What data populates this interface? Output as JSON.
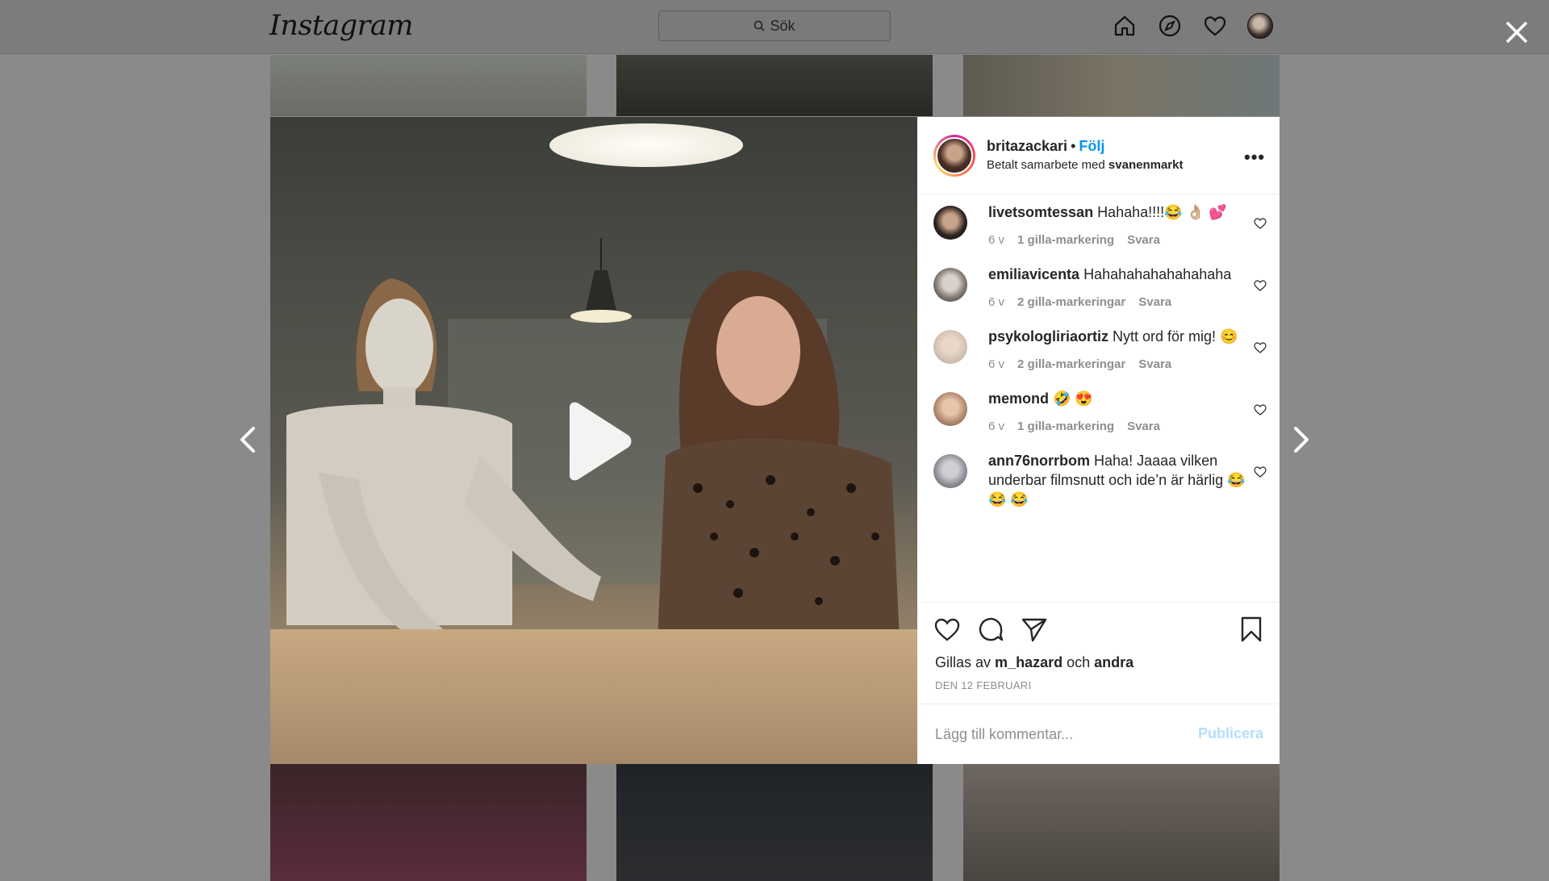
{
  "nav": {
    "logo": "Instagram",
    "search_placeholder": "Sök",
    "icons": [
      "home-icon",
      "explore-icon",
      "activity-heart-icon",
      "profile-avatar"
    ]
  },
  "modal": {
    "author": {
      "username": "britazackari",
      "separator": "•",
      "follow_label": "Följ",
      "paid_prefix": "Betalt samarbete med",
      "partner": "svanenmarkt",
      "more": "•••"
    },
    "comments": [
      {
        "user": "livetsomtessan",
        "text": "Hahaha!!!!😂 👌🏼 💕",
        "age": "6 v",
        "likes": "1 gilla-markering",
        "reply": "Svara"
      },
      {
        "user": "emiliavicenta",
        "text": "Hahahahahahahahaha",
        "age": "6 v",
        "likes": "2 gilla-markeringar",
        "reply": "Svara"
      },
      {
        "user": "psykologliriaortiz",
        "text": "Nytt ord för mig! 😊",
        "age": "6 v",
        "likes": "2 gilla-markeringar",
        "reply": "Svara"
      },
      {
        "user": "memond",
        "text": "🤣 😍",
        "age": "6 v",
        "likes": "1 gilla-markering",
        "reply": "Svara"
      },
      {
        "user": "ann76norrbom",
        "text": "Haha! Jaaaa vilken underbar filmsnutt och ide’n är härlig 😂 😂 😂",
        "age": "",
        "likes": "",
        "reply": ""
      }
    ],
    "likes": {
      "prefix": "Gillas av",
      "user": "m_hazard",
      "middle": "och",
      "others": "andra"
    },
    "date": "DEN 12 FEBRUARI",
    "add_comment": {
      "placeholder": "Lägg till kommentar...",
      "publish_label": "Publicera"
    }
  },
  "colors": {
    "link_blue": "#0095f6",
    "publish_disabled": "#b2dffc",
    "meta_gray": "#8e8e8e",
    "overlay": "#8a8a8a"
  }
}
